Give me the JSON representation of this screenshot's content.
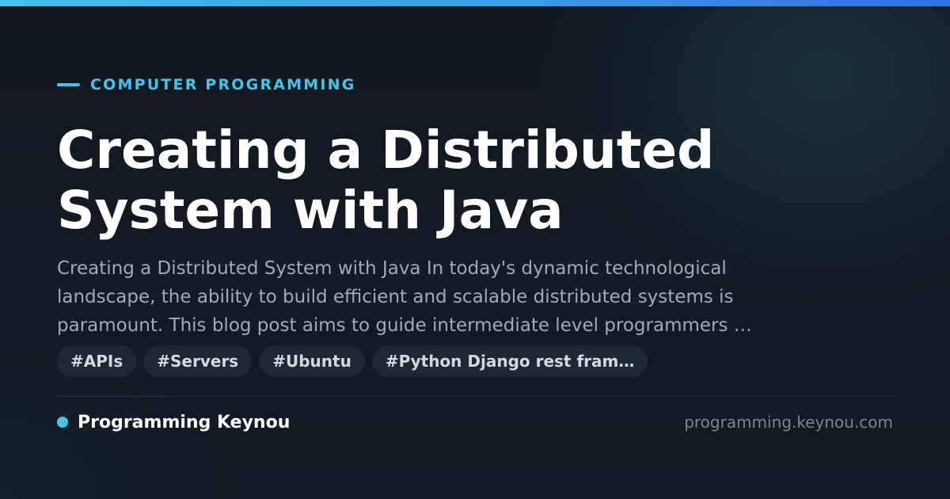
{
  "category": "COMPUTER PROGRAMMING",
  "title": "Creating a Distributed System with Java",
  "excerpt_lines": [
    "Creating a Distributed System with Java In today's dynamic technological",
    "landscape, the ability to build efficient and scalable distributed systems is",
    "paramount. This blog post aims to guide intermediate level programmers …"
  ],
  "tags": [
    "#APIs",
    "#Servers",
    "#Ubuntu",
    "#Python Django rest fram…"
  ],
  "brand": {
    "name": "Programming Keynou",
    "domain": "programming.keynou.com"
  },
  "colors": {
    "accent": "#3ec7ea",
    "background": "#111821",
    "tag_background": "#1e2833",
    "excerpt_text": "#a3aab4"
  }
}
